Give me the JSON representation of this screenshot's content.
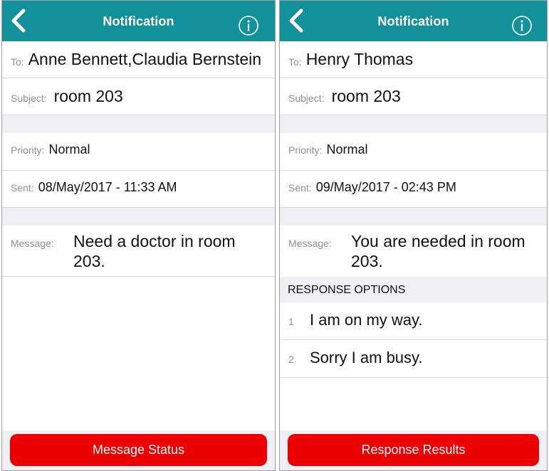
{
  "left": {
    "nav_title": "Notification",
    "to_label": "To:",
    "to_value": "Anne Bennett,Claudia Bernstein",
    "subject_label": "Subject:",
    "subject_value": "room 203",
    "priority_label": "Priority:",
    "priority_value": "Normal",
    "sent_label": "Sent:",
    "sent_value": "08/May/2017 - 11:33 AM",
    "message_label": "Message:",
    "message_value": "Need a doctor in room 203.",
    "button_label": "Message Status"
  },
  "right": {
    "nav_title": "Notification",
    "to_label": "To:",
    "to_value": "Henry Thomas",
    "subject_label": "Subject:",
    "subject_value": "room 203",
    "priority_label": "Priority:",
    "priority_value": "Normal",
    "sent_label": "Sent:",
    "sent_value": "09/May/2017 - 02:43 PM",
    "message_label": "Message:",
    "message_value": "You are needed in room 203.",
    "response_header": "RESPONSE OPTIONS",
    "options": [
      {
        "num": "1",
        "label": "I am on my way."
      },
      {
        "num": "2",
        "label": "Sorry I am busy."
      }
    ],
    "button_label": "Response Results"
  },
  "colors": {
    "navbar": "#13919b",
    "button": "#ea0000",
    "section_bg": "#efeff4"
  },
  "icons": [
    "back-chevron-icon",
    "info-icon"
  ]
}
